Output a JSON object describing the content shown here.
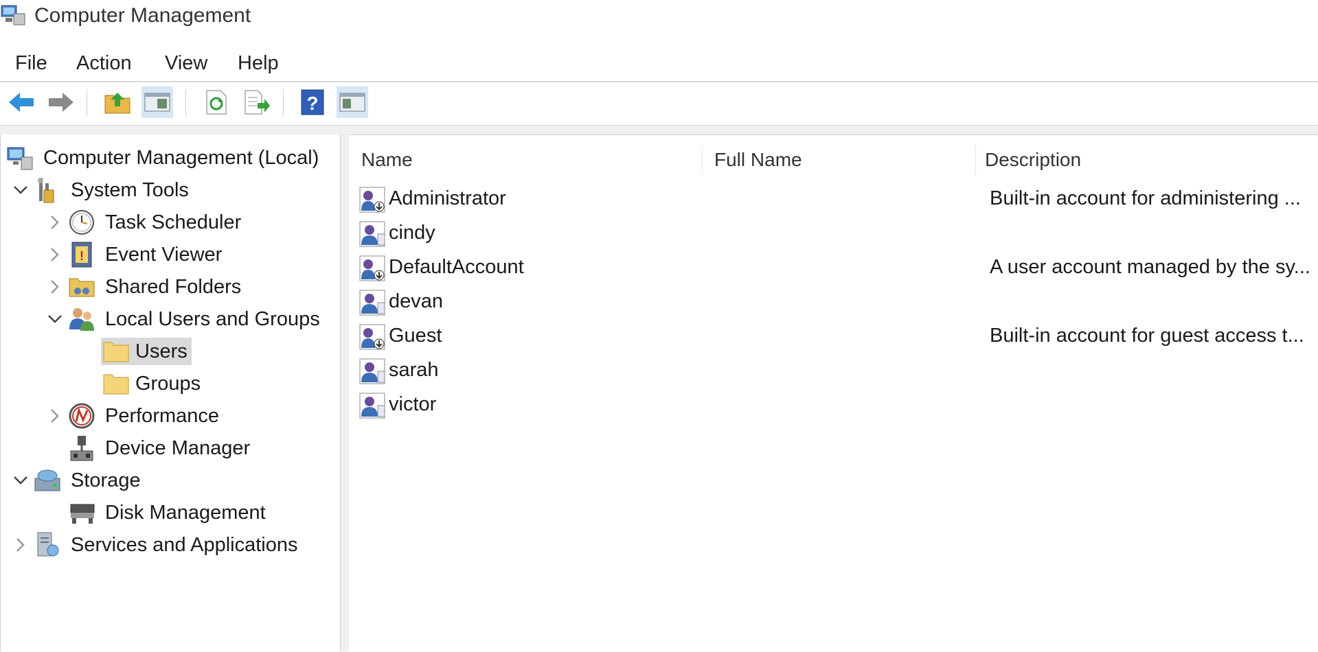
{
  "window": {
    "title": "Computer Management"
  },
  "menu": [
    "File",
    "Action",
    "View",
    "Help"
  ],
  "toolbar": {
    "buttons": [
      "back-arrow-icon",
      "forward-arrow-icon",
      "up-folder-icon",
      "show-hide-console-tree-icon",
      "refresh-icon",
      "export-list-icon",
      "help-icon",
      "show-hide-action-pane-icon"
    ]
  },
  "tree": {
    "root": "Computer Management (Local)",
    "system_tools": "System Tools",
    "task_scheduler": "Task Scheduler",
    "event_viewer": "Event Viewer",
    "shared_folders": "Shared Folders",
    "local_users_groups": "Local Users and Groups",
    "users": "Users",
    "groups": "Groups",
    "performance": "Performance",
    "device_manager": "Device Manager",
    "storage": "Storage",
    "disk_management": "Disk Management",
    "services_apps": "Services and Applications"
  },
  "list": {
    "columns": {
      "name": "Name",
      "full_name": "Full Name",
      "description": "Description"
    },
    "rows": [
      {
        "name": "Administrator",
        "full_name": "",
        "description": "Built-in account for administering ..."
      },
      {
        "name": "cindy",
        "full_name": "",
        "description": ""
      },
      {
        "name": "DefaultAccount",
        "full_name": "",
        "description": "A user account managed by the sy..."
      },
      {
        "name": "devan",
        "full_name": "",
        "description": ""
      },
      {
        "name": "Guest",
        "full_name": "",
        "description": "Built-in account for guest access t..."
      },
      {
        "name": "sarah",
        "full_name": "",
        "description": ""
      },
      {
        "name": "victor",
        "full_name": "",
        "description": ""
      }
    ]
  },
  "colors": {
    "selected_bg": "#d9d9d9",
    "toolbar_pressed": "#d6e6f5",
    "back_arrow": "#2f8fd8"
  }
}
